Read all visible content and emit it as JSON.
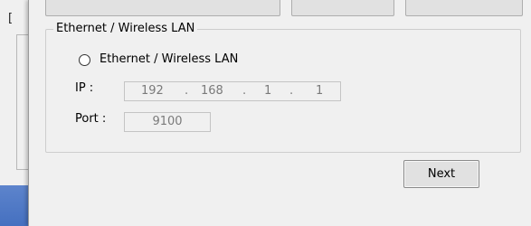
{
  "background_window": {
    "letter": "["
  },
  "group": {
    "title": "Ethernet  / Wireless LAN",
    "radio_label": "Ethernet  / Wireless LAN",
    "ip_label": "IP :",
    "ip_octets": [
      "192",
      "168",
      "1",
      "1"
    ],
    "ip_separator": ".",
    "port_label": "Port :",
    "port_value": "9100"
  },
  "buttons": {
    "next_label": "Next"
  },
  "colors": {
    "dialog_bg": "#f0f0f0",
    "taskbar_blue": "#4570c0",
    "disabled_text": "#7a7a7a"
  }
}
